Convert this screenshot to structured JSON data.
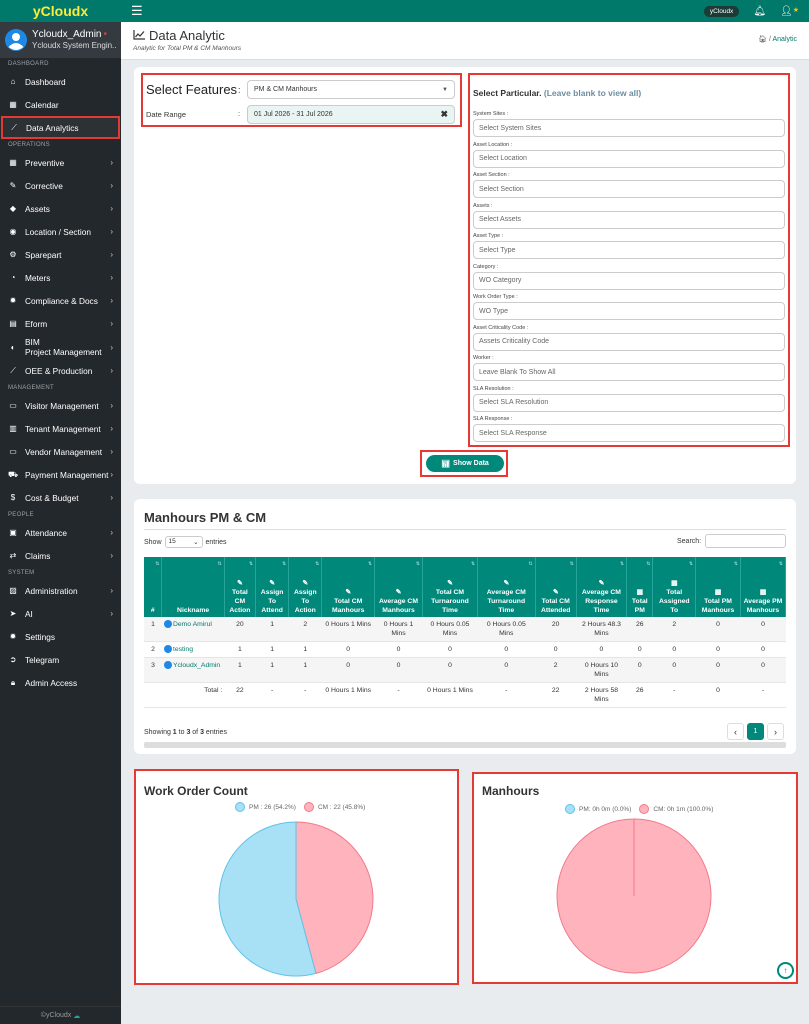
{
  "app": {
    "brand": "yCloudx",
    "user_name": "Ycloudx_Admin",
    "user_role": "Ycloudx System Engin...",
    "topbar_pill": "yCloudx",
    "footer": "©yCloudx"
  },
  "sidebar": {
    "sections": [
      {
        "title": "DASHBOARD",
        "items": [
          {
            "label": "Dashboard",
            "icon": "home-icon",
            "chev": false
          },
          {
            "label": "Calendar",
            "icon": "calendar-icon",
            "chev": false
          },
          {
            "label": "Data Analytics",
            "icon": "chart-line-icon",
            "chev": false,
            "active": true
          }
        ]
      },
      {
        "title": "OPERATIONS",
        "items": [
          {
            "label": "Preventive",
            "icon": "calendar-icon",
            "chev": true
          },
          {
            "label": "Corrective",
            "icon": "wrench-icon",
            "chev": true
          },
          {
            "label": "Assets",
            "icon": "tag-icon",
            "chev": true
          },
          {
            "label": "Location / Section",
            "icon": "location-icon",
            "chev": true
          },
          {
            "label": "Sparepart",
            "icon": "sparepart-icon",
            "chev": true
          },
          {
            "label": "Meters",
            "icon": "gauge-icon",
            "chev": true
          },
          {
            "label": "Compliance & Docs",
            "icon": "gear-icon",
            "chev": true
          },
          {
            "label": "Eform",
            "icon": "form-icon",
            "chev": true
          },
          {
            "label": "BIM",
            "label2": "Project Management",
            "icon": "bim-icon",
            "chev": true,
            "bim": true
          },
          {
            "label": "OEE & Production",
            "icon": "chart-line-icon",
            "chev": true
          }
        ]
      },
      {
        "title": "MANAGEMENT",
        "items": [
          {
            "label": "Visitor Management",
            "icon": "id-card-icon",
            "chev": true
          },
          {
            "label": "Tenant Management",
            "icon": "building-icon",
            "chev": true
          },
          {
            "label": "Vendor Management",
            "icon": "id-card-icon",
            "chev": true
          },
          {
            "label": "Payment Management",
            "icon": "cart-icon",
            "chev": true
          },
          {
            "label": "Cost & Budget",
            "icon": "dollar-icon",
            "chev": true
          }
        ]
      },
      {
        "title": "PEOPLE",
        "items": [
          {
            "label": "Attendance",
            "icon": "clipboard-icon",
            "chev": true
          },
          {
            "label": "Claims",
            "icon": "exchange-icon",
            "chev": true
          }
        ]
      },
      {
        "title": "SYSTEM",
        "items": [
          {
            "label": "Administration",
            "icon": "admin-icon",
            "chev": true
          },
          {
            "label": "AI",
            "icon": "ai-icon",
            "chev": true
          },
          {
            "label": "Settings",
            "icon": "gear-icon",
            "chev": false
          },
          {
            "label": "Telegram",
            "icon": "telegram-icon",
            "chev": false
          },
          {
            "label": "Admin Access",
            "icon": "lock-icon",
            "chev": false
          }
        ]
      }
    ]
  },
  "header": {
    "title": "Data Analytic",
    "subtitle": "Analytic for Total PM & CM Manhours",
    "breadcrumb": "Analytic"
  },
  "filters": {
    "select_features_label": "Select Features",
    "select_features_value": "PM & CM Manhours",
    "date_range_label": "Date Range",
    "date_range_value": "01 Jul 2026 - 31 Jul 2026",
    "particular_title": "Select Particular.",
    "particular_hint": "(Leave blank to view all)",
    "fields": [
      {
        "label": "System Sites :",
        "placeholder": "Select System Sites"
      },
      {
        "label": "Asset Location :",
        "placeholder": "Select Location"
      },
      {
        "label": "Asset Section :",
        "placeholder": "Select Section"
      },
      {
        "label": "Assets :",
        "placeholder": "Select Assets"
      },
      {
        "label": "Asset Type :",
        "placeholder": "Select Type"
      },
      {
        "label": "Category :",
        "placeholder": "WO Category"
      },
      {
        "label": "Work Order Type :",
        "placeholder": "WO Type"
      },
      {
        "label": "Asset Criticality Code :",
        "placeholder": "Assets Criticality Code"
      },
      {
        "label": "Worker :",
        "placeholder": "Leave Blank To Show All"
      },
      {
        "label": "SLA Resolution :",
        "placeholder": "Select SLA Resolution"
      },
      {
        "label": "SLA Response :",
        "placeholder": "Select SLA Response"
      }
    ],
    "show_button": "Show Data"
  },
  "table": {
    "title": "Manhours PM & CM",
    "show_label": "Show",
    "entries_value": "15",
    "entries_label": "entries",
    "search_label": "Search:",
    "columns": [
      {
        "label": "#",
        "icon": ""
      },
      {
        "label": "Nickname",
        "icon": ""
      },
      {
        "label": "Total CM Action",
        "icon": "wrench"
      },
      {
        "label": "Assign To Attend",
        "icon": "wrench"
      },
      {
        "label": "Assign To Action",
        "icon": "wrench"
      },
      {
        "label": "Total CM Manhours",
        "icon": "wrench"
      },
      {
        "label": "Average CM Manhours",
        "icon": "wrench"
      },
      {
        "label": "Total CM Turnaround Time",
        "icon": "wrench"
      },
      {
        "label": "Average CM Turnaround Time",
        "icon": "wrench"
      },
      {
        "label": "Total CM Attended",
        "icon": "wrench"
      },
      {
        "label": "Average CM Response Time",
        "icon": "wrench"
      },
      {
        "label": "Total PM",
        "icon": "calendar"
      },
      {
        "label": "Total Assigned To",
        "icon": "calendar"
      },
      {
        "label": "Total PM Manhours",
        "icon": "calendar"
      },
      {
        "label": "Average PM Manhours",
        "icon": "calendar"
      }
    ],
    "rows": [
      [
        "1",
        "Demo Amirul",
        "20",
        "1",
        "2",
        "0 Hours 1 Mins",
        "0 Hours 1 Mins",
        "0 Hours 0.05 Mins",
        "0 Hours 0.05 Mins",
        "20",
        "2 Hours 48.3 Mins",
        "26",
        "2",
        "0",
        "0"
      ],
      [
        "2",
        "testing",
        "1",
        "1",
        "1",
        "0",
        "0",
        "0",
        "0",
        "0",
        "0",
        "0",
        "0",
        "0",
        "0"
      ],
      [
        "3",
        "Ycloudx_Admin",
        "1",
        "1",
        "1",
        "0",
        "0",
        "0",
        "0",
        "2",
        "0 Hours 10 Mins",
        "0",
        "0",
        "0",
        "0"
      ]
    ],
    "total_row": [
      "",
      "Total :",
      "22",
      "-",
      "-",
      "0 Hours 1 Mins",
      "-",
      "0 Hours 1 Mins",
      "-",
      "22",
      "2 Hours 58 Mins",
      "26",
      "-",
      "0",
      "-"
    ],
    "showing_prefix": "Showing ",
    "showing_from": "1",
    "showing_mid1": " to ",
    "showing_to": "3",
    "showing_mid2": " of ",
    "showing_total": "3",
    "showing_suffix": " entries",
    "current_page": "1"
  },
  "chart_data": [
    {
      "type": "pie",
      "title": "Work Order Count",
      "categories": [
        "PM",
        "CM"
      ],
      "values": [
        26,
        22
      ],
      "legend": [
        "PM : 26 (54.2%)",
        "CM : 22 (45.8%)"
      ],
      "colors": [
        "#a8e0f5",
        "#ffb3bd"
      ],
      "borders": [
        "#5cc3ea",
        "#f27a89"
      ],
      "legend_position": "top"
    },
    {
      "type": "pie",
      "title": "Manhours",
      "categories": [
        "PM",
        "CM"
      ],
      "values": [
        0,
        1
      ],
      "legend": [
        "PM: 0h 0m (0.0%)",
        "CM: 0h 1m (100.0%)"
      ],
      "colors": [
        "#a8e0f5",
        "#ffb3bd"
      ],
      "borders": [
        "#5cc3ea",
        "#f27a89"
      ],
      "legend_position": "top"
    }
  ],
  "colors": {
    "primary": "#00796b",
    "accent_red": "#e53935",
    "sidebar": "#23282d"
  }
}
